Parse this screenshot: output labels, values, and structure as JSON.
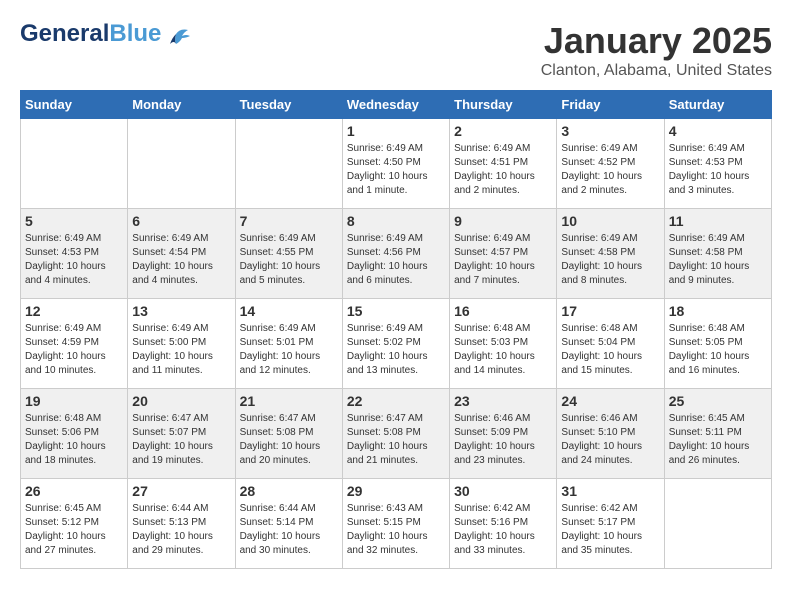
{
  "header": {
    "logo_general": "General",
    "logo_blue": "Blue",
    "month": "January 2025",
    "location": "Clanton, Alabama, United States"
  },
  "weekdays": [
    "Sunday",
    "Monday",
    "Tuesday",
    "Wednesday",
    "Thursday",
    "Friday",
    "Saturday"
  ],
  "weeks": [
    [
      {
        "day": "",
        "info": ""
      },
      {
        "day": "",
        "info": ""
      },
      {
        "day": "",
        "info": ""
      },
      {
        "day": "1",
        "info": "Sunrise: 6:49 AM\nSunset: 4:50 PM\nDaylight: 10 hours\nand 1 minute."
      },
      {
        "day": "2",
        "info": "Sunrise: 6:49 AM\nSunset: 4:51 PM\nDaylight: 10 hours\nand 2 minutes."
      },
      {
        "day": "3",
        "info": "Sunrise: 6:49 AM\nSunset: 4:52 PM\nDaylight: 10 hours\nand 2 minutes."
      },
      {
        "day": "4",
        "info": "Sunrise: 6:49 AM\nSunset: 4:53 PM\nDaylight: 10 hours\nand 3 minutes."
      }
    ],
    [
      {
        "day": "5",
        "info": "Sunrise: 6:49 AM\nSunset: 4:53 PM\nDaylight: 10 hours\nand 4 minutes."
      },
      {
        "day": "6",
        "info": "Sunrise: 6:49 AM\nSunset: 4:54 PM\nDaylight: 10 hours\nand 4 minutes."
      },
      {
        "day": "7",
        "info": "Sunrise: 6:49 AM\nSunset: 4:55 PM\nDaylight: 10 hours\nand 5 minutes."
      },
      {
        "day": "8",
        "info": "Sunrise: 6:49 AM\nSunset: 4:56 PM\nDaylight: 10 hours\nand 6 minutes."
      },
      {
        "day": "9",
        "info": "Sunrise: 6:49 AM\nSunset: 4:57 PM\nDaylight: 10 hours\nand 7 minutes."
      },
      {
        "day": "10",
        "info": "Sunrise: 6:49 AM\nSunset: 4:58 PM\nDaylight: 10 hours\nand 8 minutes."
      },
      {
        "day": "11",
        "info": "Sunrise: 6:49 AM\nSunset: 4:58 PM\nDaylight: 10 hours\nand 9 minutes."
      }
    ],
    [
      {
        "day": "12",
        "info": "Sunrise: 6:49 AM\nSunset: 4:59 PM\nDaylight: 10 hours\nand 10 minutes."
      },
      {
        "day": "13",
        "info": "Sunrise: 6:49 AM\nSunset: 5:00 PM\nDaylight: 10 hours\nand 11 minutes."
      },
      {
        "day": "14",
        "info": "Sunrise: 6:49 AM\nSunset: 5:01 PM\nDaylight: 10 hours\nand 12 minutes."
      },
      {
        "day": "15",
        "info": "Sunrise: 6:49 AM\nSunset: 5:02 PM\nDaylight: 10 hours\nand 13 minutes."
      },
      {
        "day": "16",
        "info": "Sunrise: 6:48 AM\nSunset: 5:03 PM\nDaylight: 10 hours\nand 14 minutes."
      },
      {
        "day": "17",
        "info": "Sunrise: 6:48 AM\nSunset: 5:04 PM\nDaylight: 10 hours\nand 15 minutes."
      },
      {
        "day": "18",
        "info": "Sunrise: 6:48 AM\nSunset: 5:05 PM\nDaylight: 10 hours\nand 16 minutes."
      }
    ],
    [
      {
        "day": "19",
        "info": "Sunrise: 6:48 AM\nSunset: 5:06 PM\nDaylight: 10 hours\nand 18 minutes."
      },
      {
        "day": "20",
        "info": "Sunrise: 6:47 AM\nSunset: 5:07 PM\nDaylight: 10 hours\nand 19 minutes."
      },
      {
        "day": "21",
        "info": "Sunrise: 6:47 AM\nSunset: 5:08 PM\nDaylight: 10 hours\nand 20 minutes."
      },
      {
        "day": "22",
        "info": "Sunrise: 6:47 AM\nSunset: 5:08 PM\nDaylight: 10 hours\nand 21 minutes."
      },
      {
        "day": "23",
        "info": "Sunrise: 6:46 AM\nSunset: 5:09 PM\nDaylight: 10 hours\nand 23 minutes."
      },
      {
        "day": "24",
        "info": "Sunrise: 6:46 AM\nSunset: 5:10 PM\nDaylight: 10 hours\nand 24 minutes."
      },
      {
        "day": "25",
        "info": "Sunrise: 6:45 AM\nSunset: 5:11 PM\nDaylight: 10 hours\nand 26 minutes."
      }
    ],
    [
      {
        "day": "26",
        "info": "Sunrise: 6:45 AM\nSunset: 5:12 PM\nDaylight: 10 hours\nand 27 minutes."
      },
      {
        "day": "27",
        "info": "Sunrise: 6:44 AM\nSunset: 5:13 PM\nDaylight: 10 hours\nand 29 minutes."
      },
      {
        "day": "28",
        "info": "Sunrise: 6:44 AM\nSunset: 5:14 PM\nDaylight: 10 hours\nand 30 minutes."
      },
      {
        "day": "29",
        "info": "Sunrise: 6:43 AM\nSunset: 5:15 PM\nDaylight: 10 hours\nand 32 minutes."
      },
      {
        "day": "30",
        "info": "Sunrise: 6:42 AM\nSunset: 5:16 PM\nDaylight: 10 hours\nand 33 minutes."
      },
      {
        "day": "31",
        "info": "Sunrise: 6:42 AM\nSunset: 5:17 PM\nDaylight: 10 hours\nand 35 minutes."
      },
      {
        "day": "",
        "info": ""
      }
    ]
  ]
}
